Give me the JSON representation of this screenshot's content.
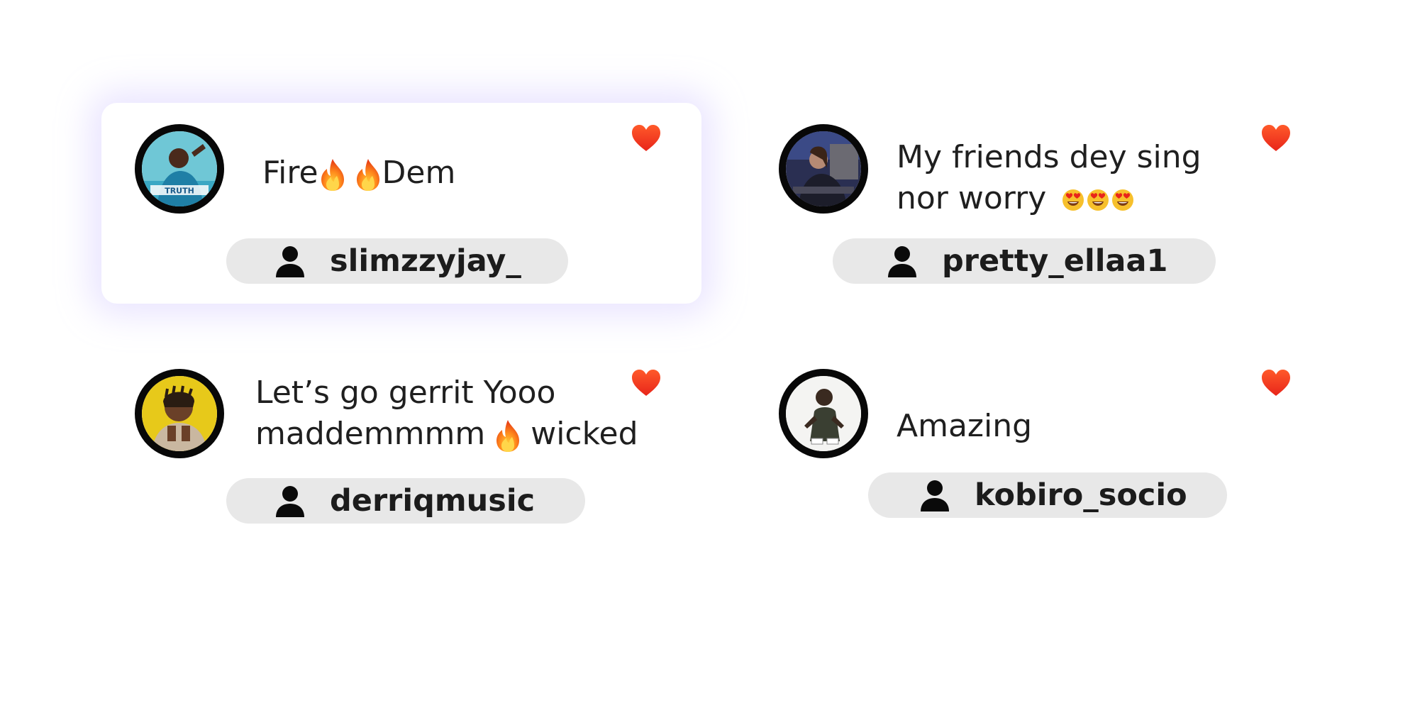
{
  "comments": [
    {
      "text_before": "Fire",
      "text_middle": "",
      "text_after": "Dem",
      "username": "slimzzyjay_",
      "avatar_label": "TRUTH",
      "liked": true,
      "highlighted": true
    },
    {
      "line1": "My friends dey sing",
      "line2": "nor worry",
      "username": "pretty_ellaa1",
      "liked": true,
      "highlighted": false
    },
    {
      "line1": "Let’s go gerrit Yooo",
      "line2_before": "maddemmmm",
      "line2_after": "wicked",
      "username": "derriqmusic",
      "liked": true,
      "highlighted": false
    },
    {
      "line1": "Amazing",
      "username": "kobiro_socio",
      "liked": true,
      "highlighted": false
    }
  ],
  "icons": {
    "like": "heart-icon",
    "user": "user-icon",
    "fire": "fire-emoji",
    "heart_eyes": "heart-eyes-emoji"
  },
  "colors": {
    "heart": "#f03a1f",
    "pill_bg": "#e8e8e8",
    "avatar_ring": "#080808",
    "highlight_glow": "#c4b8ff"
  }
}
